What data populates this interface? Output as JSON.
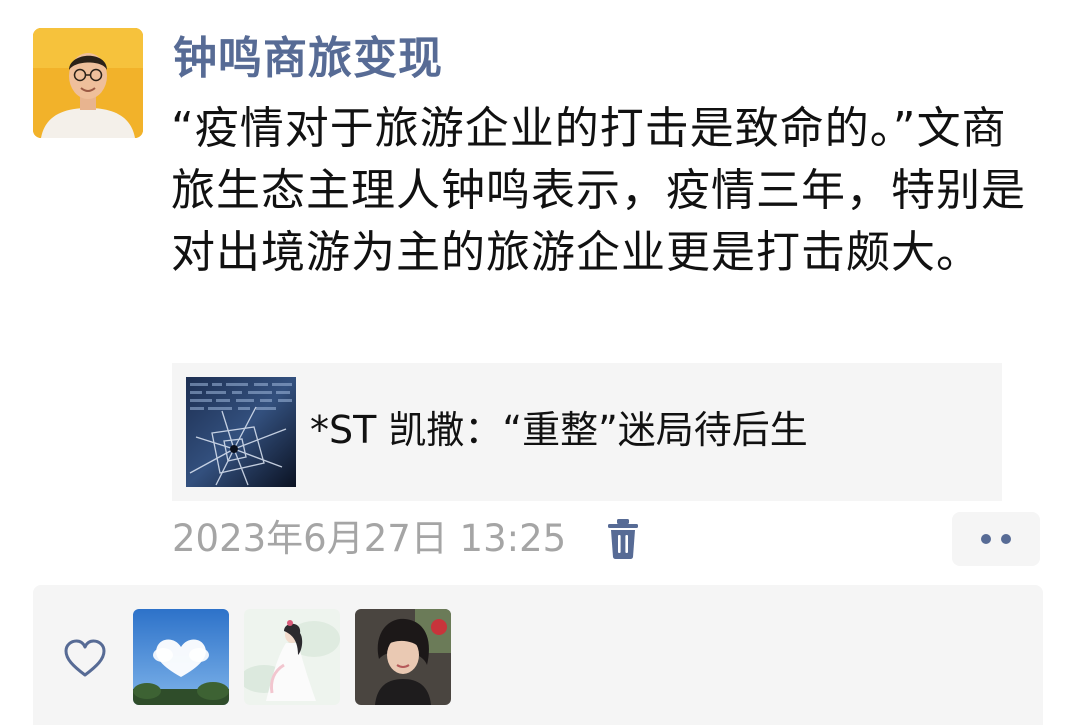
{
  "post": {
    "author": "钟鸣商旅变现",
    "text": "“疫情对于旅游企业的打击是致命的。”文商旅生态主理人钟鸣表示，疫情三年，特别是对出境游为主的旅游企业更是打击颇大。",
    "link_title": "*ST 凯撒：“重整”迷局待后生",
    "timestamp": "2023年6月27日 13:25"
  },
  "icons": {
    "delete": "trash-icon",
    "more": "more-dots-icon",
    "like": "heart-icon"
  },
  "colors": {
    "link_blue": "#576b95",
    "timestamp_gray": "#a5a5a5",
    "panel_bg": "#f5f5f5",
    "text": "#111111"
  },
  "likes": {
    "users": [
      "liker-1",
      "liker-2",
      "liker-3"
    ]
  }
}
